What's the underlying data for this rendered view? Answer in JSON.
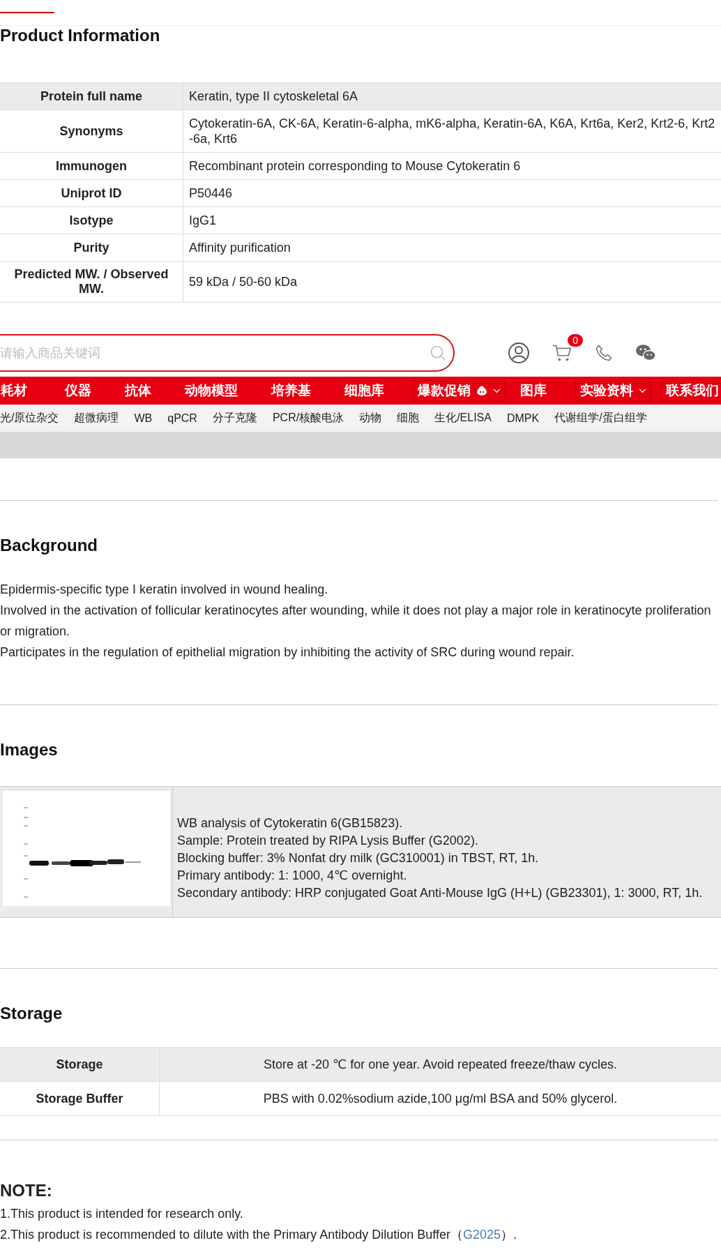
{
  "product_info": {
    "title": "Product Information",
    "rows": [
      {
        "label": "Protein full name",
        "value": "Keratin, type II cytoskeletal 6A"
      },
      {
        "label": "Synonyms",
        "value": "Cytokeratin-6A, CK-6A, Keratin-6-alpha, mK6-alpha, Keratin-6A, K6A, Krt6a, Ker2, Krt2-6, Krt2-6a, Krt6"
      },
      {
        "label": "Immunogen",
        "value": "Recombinant protein corresponding to Mouse Cytokeratin 6"
      },
      {
        "label": "Uniprot ID",
        "value": "P50446"
      },
      {
        "label": "Isotype",
        "value": "IgG1"
      },
      {
        "label": "Purity",
        "value": "Affinity purification"
      },
      {
        "label": "Predicted MW. / Observed MW.",
        "value": "59 kDa / 50-60 kDa"
      }
    ]
  },
  "header": {
    "search": {
      "placeholder": "请输入商品关键词"
    },
    "cart_count": "0"
  },
  "nav": {
    "items": [
      {
        "label": "耗材",
        "kind": "link",
        "hot": false
      },
      {
        "label": "仪器",
        "kind": "link",
        "hot": false
      },
      {
        "label": "抗体",
        "kind": "link",
        "hot": false
      },
      {
        "label": "动物模型",
        "kind": "link",
        "hot": false
      },
      {
        "label": "培养基",
        "kind": "link",
        "hot": false
      },
      {
        "label": "细胞库",
        "kind": "link",
        "hot": false
      },
      {
        "label": "爆款促销",
        "kind": "menu",
        "hot": true
      },
      {
        "label": "图库",
        "kind": "link",
        "hot": false
      },
      {
        "label": "实验资料",
        "kind": "menu",
        "hot": false
      },
      {
        "label": "联系我们",
        "kind": "box",
        "hot": false
      }
    ]
  },
  "subnav": [
    "光/原位杂交",
    "超微病理",
    "WB",
    "qPCR",
    "分子克隆",
    "PCR/核酸电泳",
    "动物",
    "细胞",
    "生化/ELISA",
    "DMPK",
    "代谢组学/蛋白组学"
  ],
  "background": {
    "title": "Background",
    "paragraphs": [
      "Epidermis-specific type I keratin involved in wound healing.",
      "Involved in the activation of follicular keratinocytes after wounding, while it does not play a major role in keratinocyte proliferation or migration.",
      "Participates in the regulation of epithelial migration by inhibiting the activity of SRC during wound repair."
    ]
  },
  "images": {
    "title": "Images",
    "items": [
      {
        "caption": [
          "WB analysis of Cytokeratin 6(GB15823).",
          "Sample: Protein treated by RIPA Lysis Buffer (G2002).",
          "Blocking buffer: 3% Nonfat dry milk (GC310001) in TBST, RT, 1h.",
          "Primary antibody: 1: 1000, 4℃ overnight.",
          "Secondary antibody: HRP conjugated Goat Anti-Mouse IgG (H+L) (GB23301), 1: 3000, RT, 1h."
        ]
      }
    ]
  },
  "storage": {
    "title": "Storage",
    "rows": [
      {
        "label": "Storage",
        "value": "Store at -20 ℃ for one year. Avoid repeated freeze/thaw cycles."
      },
      {
        "label": "Storage Buffer",
        "value": "PBS with 0.02%sodium azide,100 μg/ml BSA and 50% glycerol."
      }
    ]
  },
  "note": {
    "title": "NOTE:",
    "lines": [
      {
        "text": "1.This product is intended for research only."
      },
      {
        "text": "2.This product is recommended to dilute with the Primary Antibody Dilution Buffer（",
        "link": "G2025",
        "after": "）."
      }
    ]
  }
}
